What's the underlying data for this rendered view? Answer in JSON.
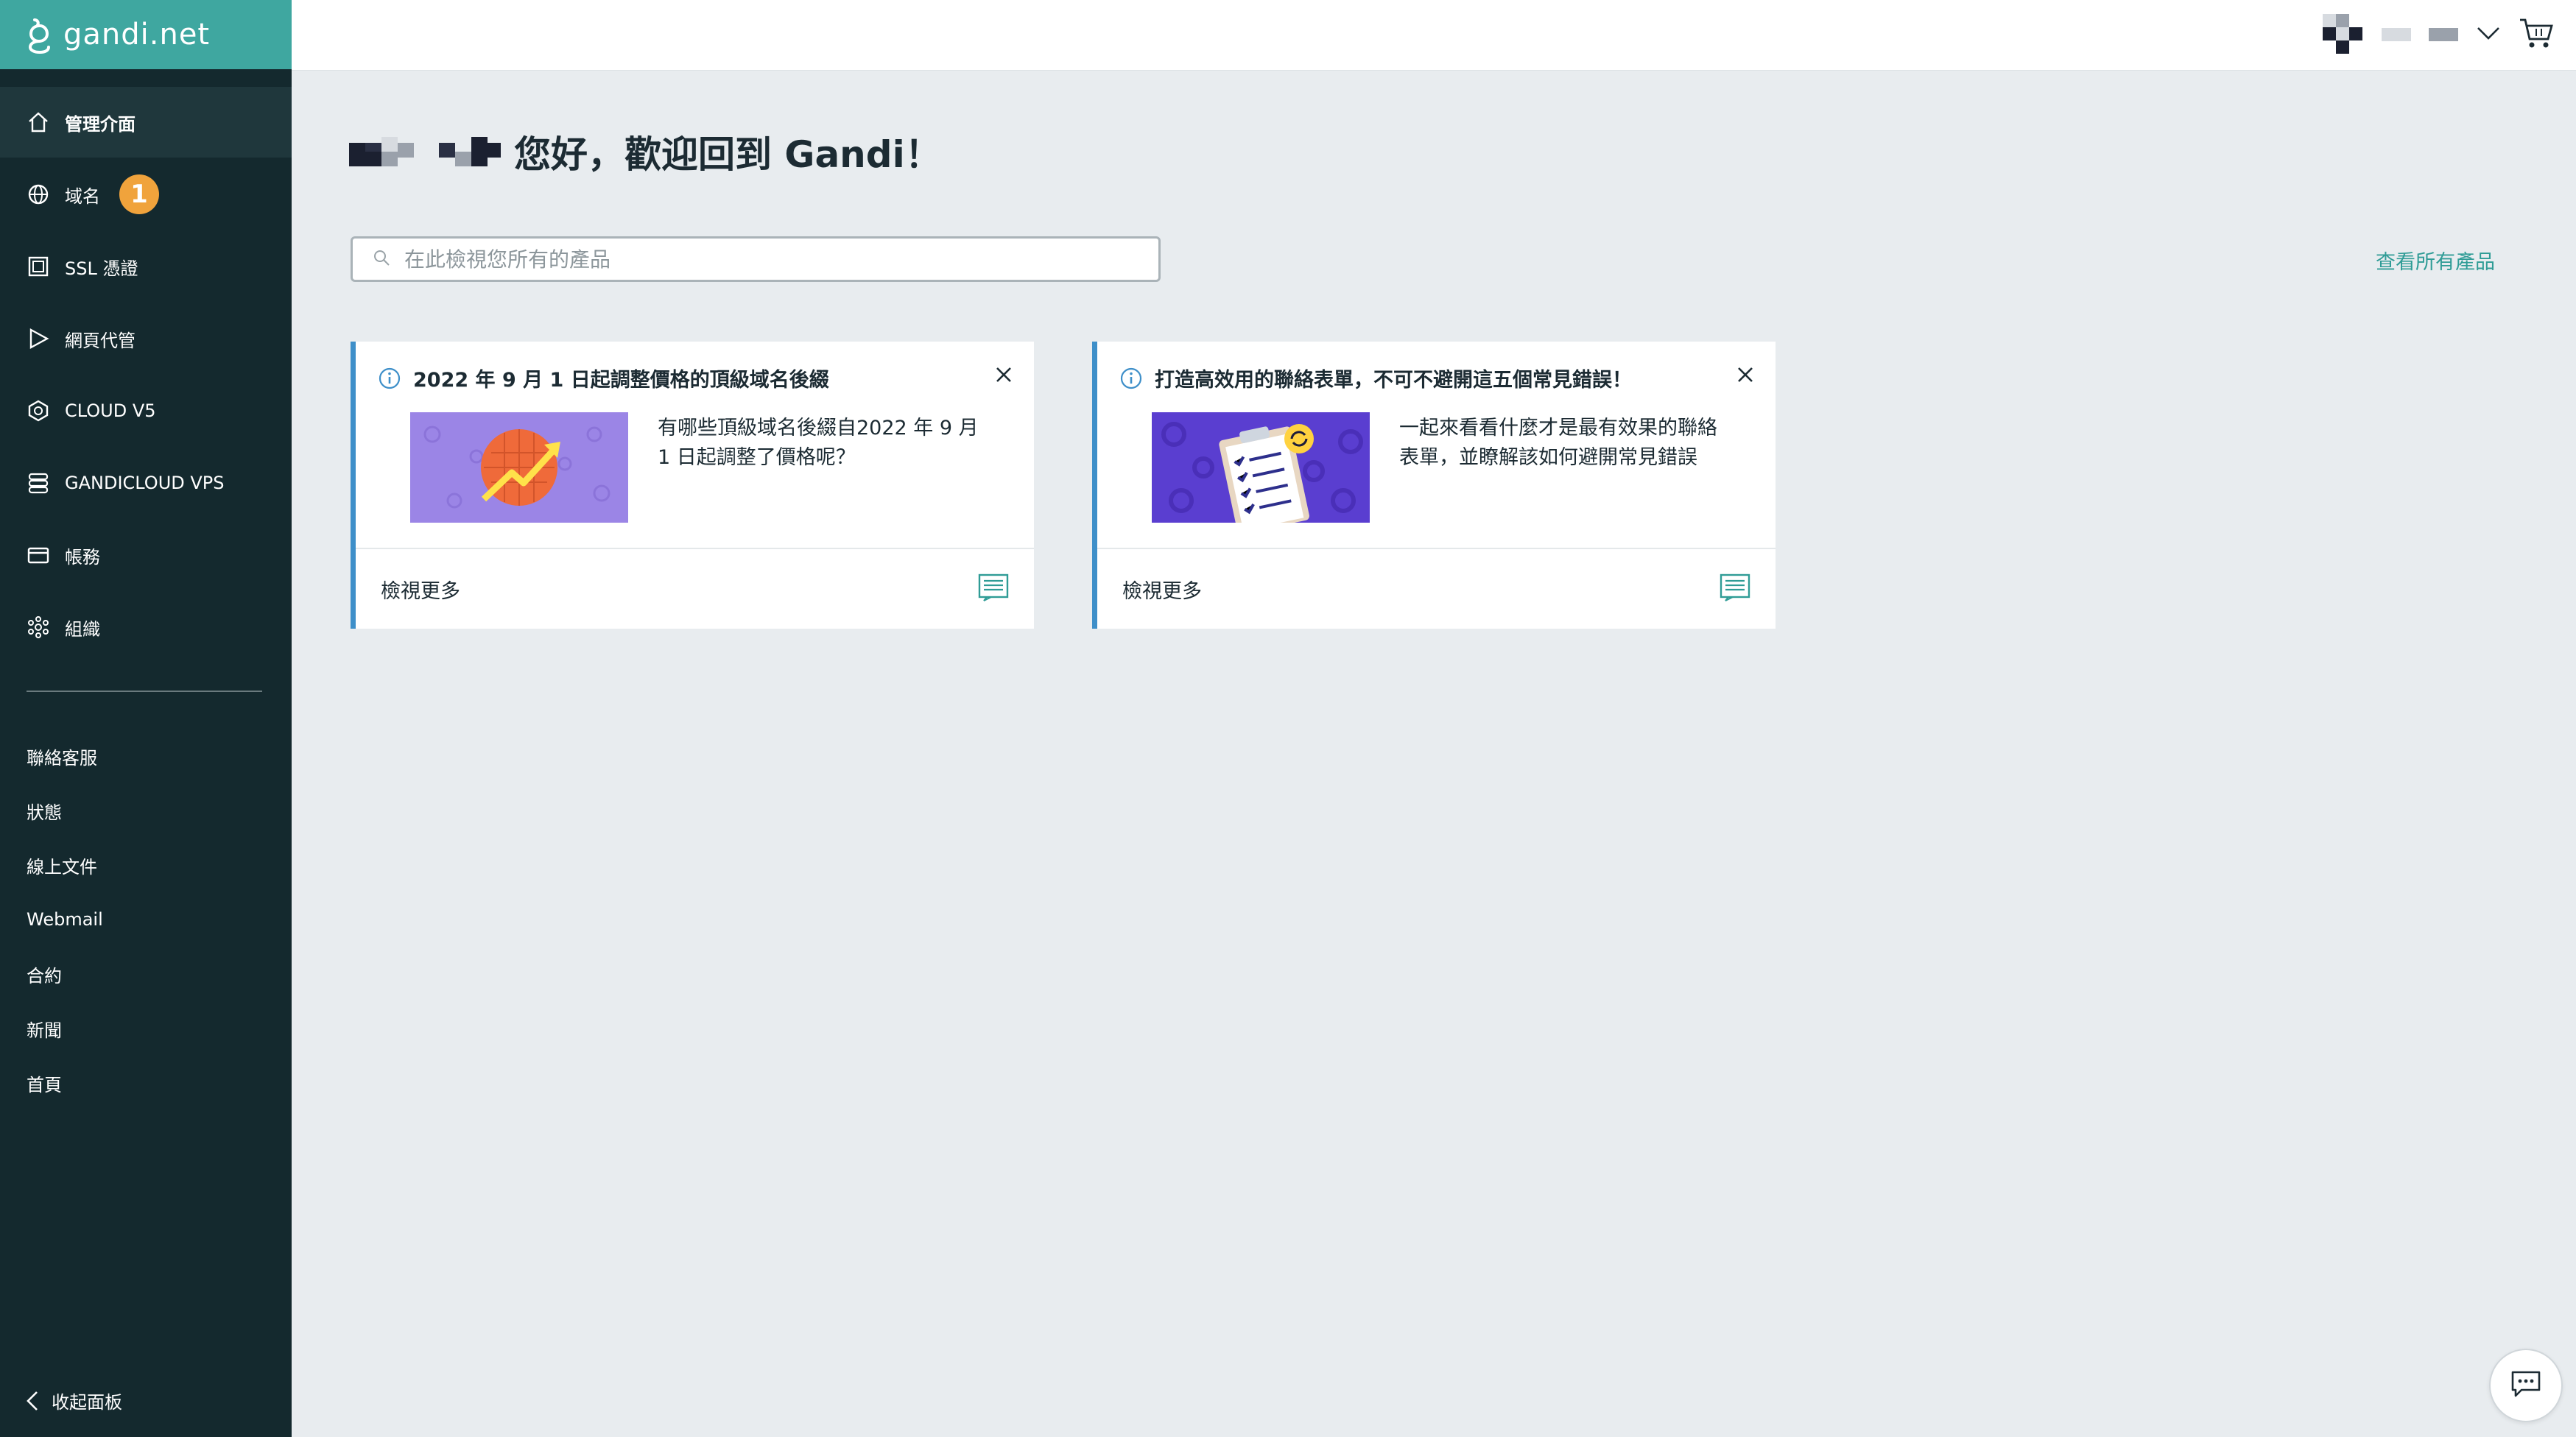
{
  "brand": {
    "name": "gandi.net",
    "logo_color": "#3fa7a0",
    "sidebar_color": "#14292e"
  },
  "sidebar": {
    "items": [
      {
        "label": "管理介面",
        "icon": "home-icon"
      },
      {
        "label": "域名",
        "icon": "globe-icon",
        "badge": "1"
      },
      {
        "label": "SSL 憑證",
        "icon": "certificate-icon"
      },
      {
        "label": "網頁代管",
        "icon": "play-icon"
      },
      {
        "label": "CLOUD V5",
        "icon": "cloud-icon"
      },
      {
        "label": "GANDICLOUD VPS",
        "icon": "server-stack-icon"
      },
      {
        "label": "帳務",
        "icon": "credit-card-icon"
      },
      {
        "label": "組織",
        "icon": "organization-icon"
      }
    ],
    "links": [
      "聯絡客服",
      "狀態",
      "線上文件",
      "Webmail",
      "合約",
      "新聞",
      "首頁"
    ],
    "collapse_label": "收起面板"
  },
  "main": {
    "greeting": "您好，歡迎回到 Gandi！",
    "search": {
      "placeholder": "在此檢視您所有的產品"
    },
    "view_all": "查看所有產品"
  },
  "cards": [
    {
      "title": "2022 年 9 月 1 日起調整價格的頂級域名後綴",
      "description": "有哪些頂級域名後綴自2022 年 9 月 1 日起調整了價格呢？",
      "more": "檢視更多"
    },
    {
      "title": "打造高效用的聯絡表單，不可不避開這五個常見錯誤！",
      "description": "一起來看看什麼才是最有效果的聯絡表單，並瞭解該如何避開常見錯誤",
      "more": "檢視更多"
    }
  ],
  "colors": {
    "accent": "#2f9c96",
    "card_border": "#3e8fc9",
    "badge": "#f0a33c"
  }
}
